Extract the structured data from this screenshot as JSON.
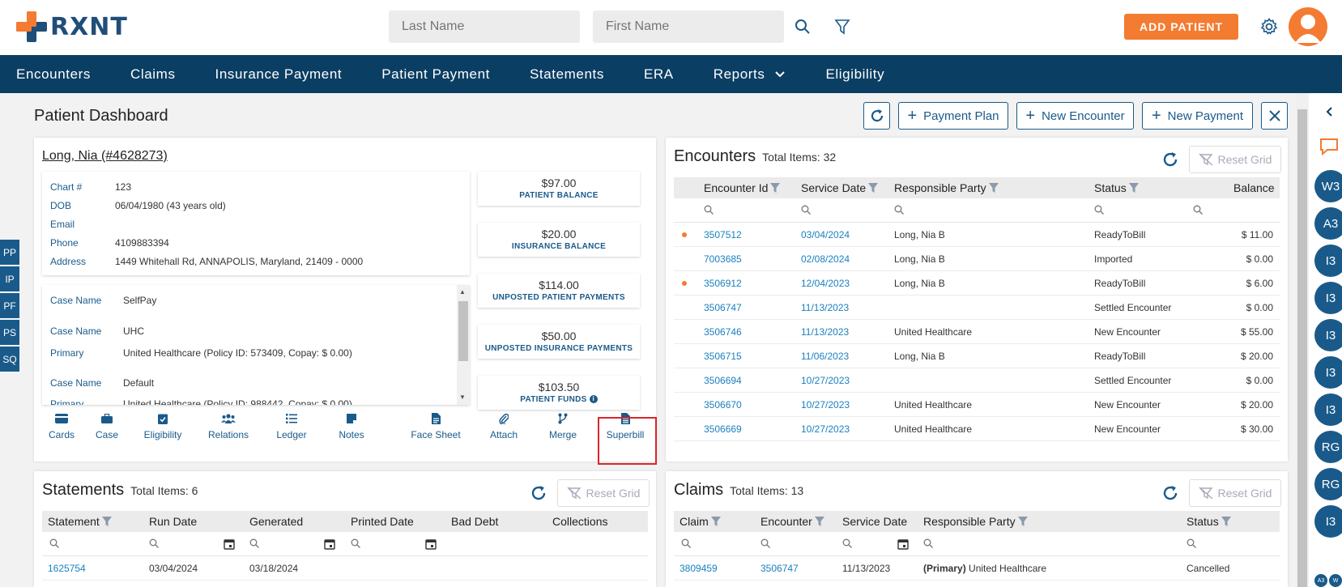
{
  "header": {
    "logo": "RXNT",
    "last_name_placeholder": "Last Name",
    "first_name_placeholder": "First Name",
    "add_patient_label": "ADD PATIENT"
  },
  "nav": {
    "items": [
      "Encounters",
      "Claims",
      "Insurance Payment",
      "Patient Payment",
      "Statements",
      "ERA",
      "Reports",
      "Eligibility"
    ]
  },
  "page": {
    "title": "Patient Dashboard",
    "payment_plan_label": "Payment Plan",
    "new_encounter_label": "New Encounter",
    "new_payment_label": "New Payment"
  },
  "patient": {
    "name": "Long, Nia (#4628273)",
    "info": [
      {
        "label": "Chart #",
        "value": "123"
      },
      {
        "label": "DOB",
        "value": "06/04/1980 (43 years old)"
      },
      {
        "label": "Email",
        "value": ""
      },
      {
        "label": "Phone",
        "value": "4109883394"
      },
      {
        "label": "Address",
        "value": "1449 Whitehall Rd, ANNAPOLIS, Maryland, 21409 - 0000"
      }
    ],
    "cases": [
      {
        "label": "Case Name",
        "value": "SelfPay"
      },
      {
        "label": "Case Name",
        "value": "UHC"
      },
      {
        "label": "Primary",
        "value": "United Healthcare (Policy ID: 573409, Copay: $ 0.00)"
      },
      {
        "label": "Case Name",
        "value": "Default"
      },
      {
        "label": "Primary",
        "value": "United Healthcare (Policy ID: 988442, Copay: $ 0.00)"
      }
    ],
    "balances": [
      {
        "amount": "$97.00",
        "label": "PATIENT BALANCE"
      },
      {
        "amount": "$20.00",
        "label": "INSURANCE BALANCE"
      },
      {
        "amount": "$114.00",
        "label": "UNPOSTED PATIENT PAYMENTS"
      },
      {
        "amount": "$50.00",
        "label": "UNPOSTED INSURANCE PAYMENTS"
      },
      {
        "amount": "$103.50",
        "label": "PATIENT FUNDS"
      }
    ],
    "actions": [
      "Cards",
      "Case",
      "Eligibility",
      "Relations",
      "Ledger",
      "Notes",
      "Face Sheet",
      "Attach",
      "Merge",
      "Superbill"
    ]
  },
  "encounters": {
    "title": "Encounters",
    "count": "Total Items: 32",
    "reset_label": "Reset Grid",
    "columns": [
      "Encounter Id",
      "Service Date",
      "Responsible Party",
      "Status",
      "Balance"
    ],
    "rows": [
      {
        "id": "3507512",
        "date": "03/04/2024",
        "party": "Long, Nia B",
        "status": "ReadyToBill",
        "balance": "$ 11.00",
        "dot": true
      },
      {
        "id": "7003685",
        "date": "02/08/2024",
        "party": "Long, Nia B",
        "status": "Imported",
        "balance": "$ 0.00",
        "dot": false
      },
      {
        "id": "3506912",
        "date": "12/04/2023",
        "party": "Long, Nia B",
        "status": "ReadyToBill",
        "balance": "$ 6.00",
        "dot": true
      },
      {
        "id": "3506747",
        "date": "11/13/2023",
        "party": "",
        "status": "Settled Encounter",
        "balance": "$ 0.00",
        "dot": false
      },
      {
        "id": "3506746",
        "date": "11/13/2023",
        "party": "United Healthcare",
        "status": "New Encounter",
        "balance": "$ 55.00",
        "dot": false
      },
      {
        "id": "3506715",
        "date": "11/06/2023",
        "party": "Long, Nia B",
        "status": "ReadyToBill",
        "balance": "$ 20.00",
        "dot": false
      },
      {
        "id": "3506694",
        "date": "10/27/2023",
        "party": "",
        "status": "Settled Encounter",
        "balance": "$ 0.00",
        "dot": false
      },
      {
        "id": "3506670",
        "date": "10/27/2023",
        "party": "United Healthcare",
        "status": "New Encounter",
        "balance": "$ 20.00",
        "dot": false
      },
      {
        "id": "3506669",
        "date": "10/27/2023",
        "party": "United Healthcare",
        "status": "New Encounter",
        "balance": "$ 30.00",
        "dot": false
      }
    ]
  },
  "statements": {
    "title": "Statements",
    "count": "Total Items: 6",
    "reset_label": "Reset Grid",
    "columns": [
      "Statement",
      "Run Date",
      "Generated",
      "Printed Date",
      "Bad Debt",
      "Collections"
    ],
    "rows": [
      {
        "statement": "1625754",
        "run_date": "03/04/2024",
        "generated": "03/18/2024",
        "printed": "",
        "bad_debt": "",
        "collections": ""
      }
    ]
  },
  "claims": {
    "title": "Claims",
    "count": "Total Items: 13",
    "reset_label": "Reset Grid",
    "columns": [
      "Claim",
      "Encounter",
      "Service Date",
      "Responsible Party",
      "Status"
    ],
    "rows": [
      {
        "claim": "3809459",
        "encounter": "3506747",
        "date": "11/13/2023",
        "party_prefix": "(Primary)",
        "party": "United Healthcare",
        "status": "Cancelled"
      }
    ]
  },
  "left_tabs": [
    "PP",
    "IP",
    "PF",
    "PS",
    "SQ"
  ],
  "right_circles": [
    "W3",
    "A3",
    "I3",
    "I3",
    "I3",
    "I3",
    "I3",
    "RG",
    "RG",
    "I3"
  ],
  "right_small": [
    "A3",
    "W"
  ],
  "colors": {
    "accent": "#f47b32",
    "nav": "#0b3e63",
    "link": "#1a7fbf",
    "primary": "#1a5a8a"
  }
}
